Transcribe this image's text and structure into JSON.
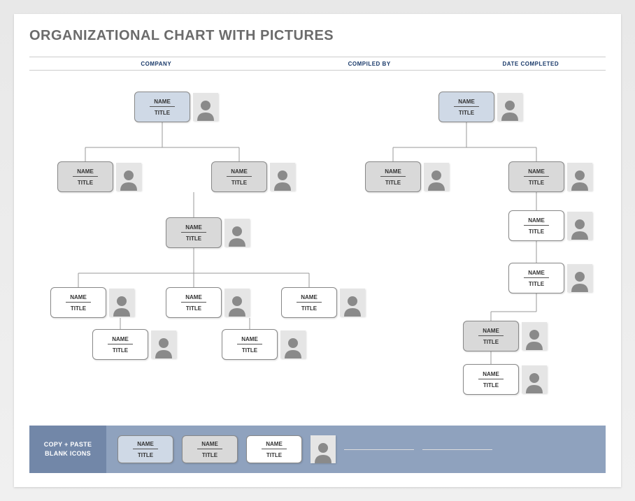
{
  "title": "ORGANIZATIONAL CHART WITH PICTURES",
  "meta": {
    "company_label": "COMPANY",
    "compiled_label": "COMPILED BY",
    "date_label": "DATE COMPLETED"
  },
  "labels": {
    "name": "NAME",
    "title": "TITLE"
  },
  "footer": {
    "line1": "COPY + PASTE",
    "line2": "BLANK ICONS"
  }
}
